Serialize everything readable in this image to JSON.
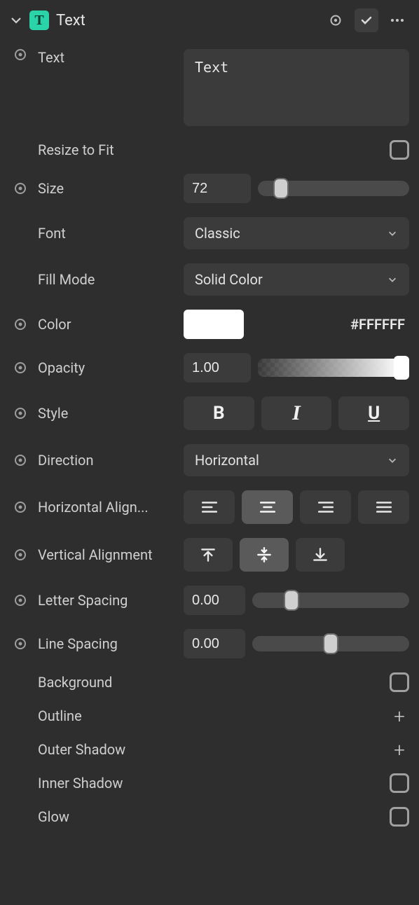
{
  "header": {
    "title": "Text",
    "badge_letter": "T"
  },
  "text": {
    "label": "Text",
    "value": "Text"
  },
  "resize": {
    "label": "Resize to Fit",
    "checked": false
  },
  "size": {
    "label": "Size",
    "value": "72"
  },
  "font": {
    "label": "Font",
    "value": "Classic"
  },
  "fill_mode": {
    "label": "Fill Mode",
    "value": "Solid Color"
  },
  "color": {
    "label": "Color",
    "hex": "#FFFFFF",
    "swatch": "#FFFFFF"
  },
  "opacity": {
    "label": "Opacity",
    "value": "1.00"
  },
  "style": {
    "label": "Style"
  },
  "direction": {
    "label": "Direction",
    "value": "Horizontal"
  },
  "halign": {
    "label": "Horizontal Align..."
  },
  "valign": {
    "label": "Vertical Alignment"
  },
  "letter_spacing": {
    "label": "Letter Spacing",
    "value": "0.00"
  },
  "line_spacing": {
    "label": "Line Spacing",
    "value": "0.00"
  },
  "background": {
    "label": "Background",
    "checked": false
  },
  "outline": {
    "label": "Outline"
  },
  "outer_shadow": {
    "label": "Outer Shadow"
  },
  "inner_shadow": {
    "label": "Inner Shadow",
    "checked": false
  },
  "glow": {
    "label": "Glow",
    "checked": false
  }
}
